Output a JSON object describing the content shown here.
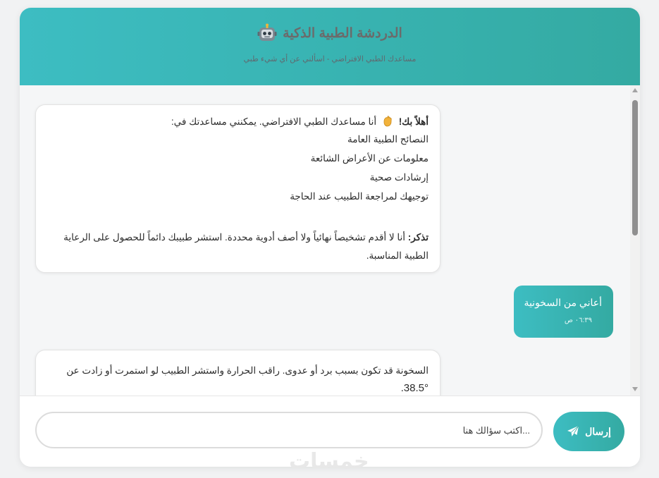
{
  "header": {
    "title": "الدردشة الطبية الذكية",
    "subtitle": "مساعدك الطبي الافتراضي - اسألني عن أي شيء طبي",
    "robot_icon": "robot-icon"
  },
  "messages": {
    "welcome": {
      "greeting": "أهلاً بك!",
      "intro": "أنا مساعدك الطبي الافتراضي. يمكنني مساعدتك في:",
      "items": [
        "النصائح الطبية العامة",
        "معلومات عن الأعراض الشائعة",
        "إرشادات صحية",
        "توجيهك لمراجعة الطبيب عند الحاجة"
      ],
      "reminder_label": "تذكر:",
      "reminder_text": "أنا لا أقدم تشخيصاً نهائياً ولا أصف أدوية محددة. استشر طبيبك دائماً للحصول على الرعاية الطبية المناسبة."
    },
    "user": {
      "text": "أعاني من السخونية",
      "time": "٠٦:٣٩ ص"
    },
    "reply": {
      "line1": "السخونة قد تكون بسبب برد أو عدوى. راقب الحرارة واستشر الطبيب لو استمرت أو زادت عن",
      "line2": "38.5°."
    }
  },
  "input": {
    "placeholder": "...اكتب سؤالك هنا",
    "send_label": "إرسال"
  },
  "watermark": "خمسات",
  "colors": {
    "accent_start": "#3dbdc2",
    "accent_end": "#34aaa2"
  }
}
